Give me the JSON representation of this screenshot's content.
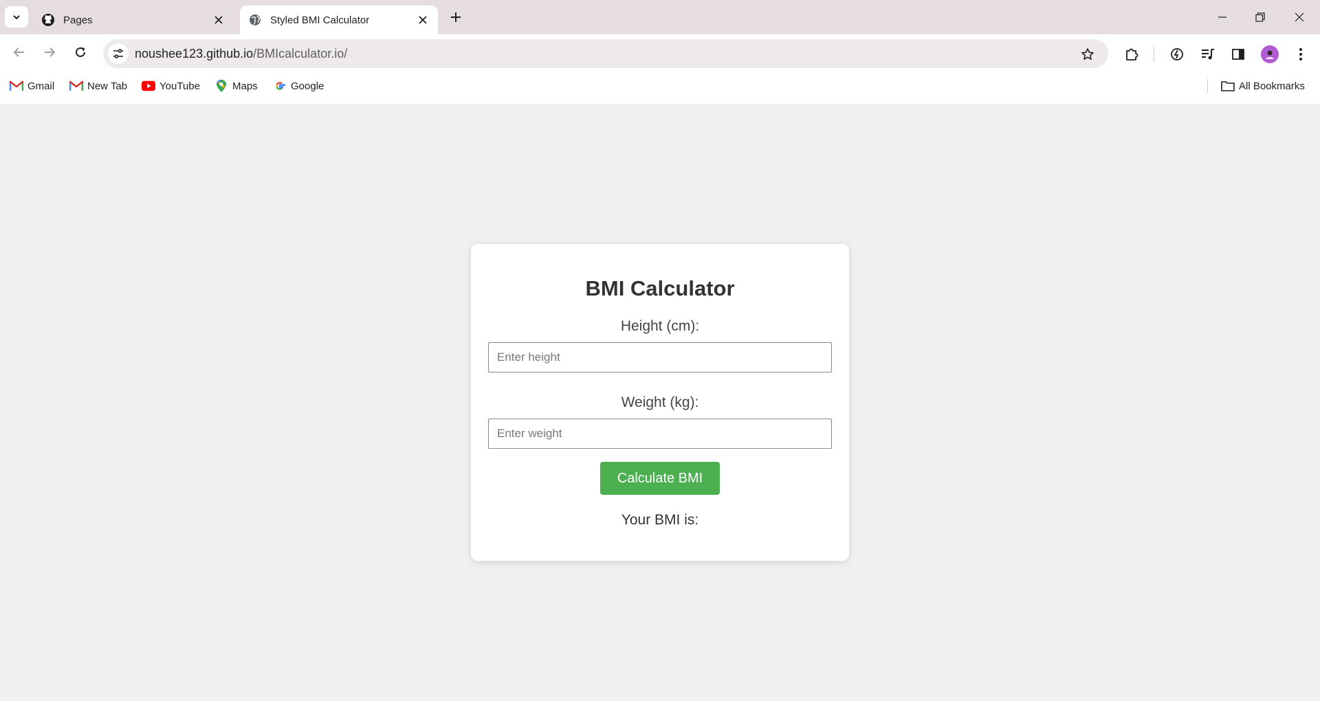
{
  "browser": {
    "tabs": [
      {
        "title": "Pages",
        "icon": "github-icon",
        "active": false
      },
      {
        "title": "Styled BMI Calculator",
        "icon": "globe-icon",
        "active": true
      }
    ],
    "url_host": "noushee123.github.io",
    "url_path": "/BMIcalculator.io/",
    "bookmarks": [
      {
        "label": "Gmail",
        "icon": "gmail-icon"
      },
      {
        "label": "New Tab",
        "icon": "gmail-icon"
      },
      {
        "label": "YouTube",
        "icon": "youtube-icon"
      },
      {
        "label": "Maps",
        "icon": "maps-pin-icon"
      },
      {
        "label": "Google",
        "icon": "google-icon"
      }
    ],
    "all_bookmarks_label": "All Bookmarks",
    "colors": {
      "tabstrip": "#e6dede",
      "avatar": "#b05ad6"
    }
  },
  "page": {
    "title": "BMI Calculator",
    "height_label": "Height (cm):",
    "height_placeholder": "Enter height",
    "weight_label": "Weight (kg):",
    "weight_placeholder": "Enter weight",
    "button_label": "Calculate BMI",
    "result_label": "Your BMI is:",
    "colors": {
      "button": "#4caf50",
      "background": "#f0f0f0",
      "card": "#ffffff"
    }
  }
}
